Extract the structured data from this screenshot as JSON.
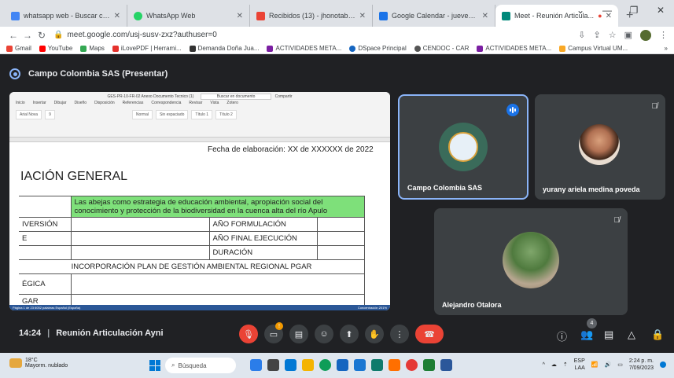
{
  "browser": {
    "tabs": [
      {
        "label": "whatsapp web - Buscar con ...",
        "color": "#4285f4"
      },
      {
        "label": "WhatsApp Web",
        "color": "#25d366"
      },
      {
        "label": "Recibidos (13) - jhonotabo...",
        "color": "#ea4335"
      },
      {
        "label": "Google Calendar - jueves, 7...",
        "color": "#1a73e8"
      },
      {
        "label": "Meet - Reunión Articula...",
        "color": "#00897b"
      }
    ],
    "new_tab": "+",
    "url": "meet.google.com/usj-susv-zxz?authuser=0",
    "bookmarks": [
      "Gmail",
      "YouTube",
      "Maps",
      "iLovePDF | Herrami...",
      "Demanda Doña Jua...",
      "ACTIVIDADES META...",
      "DSpace Principal",
      "CENDOC - CAR",
      "ACTIVIDADES META...",
      "Campus Virtual UM..."
    ],
    "bookmarks_more": "»"
  },
  "meet": {
    "presenting_label": "Campo Colombia SAS (Presentar)",
    "meeting_time": "14:24",
    "meeting_name": "Reunión Articulación Ayni",
    "participant_count": "4",
    "participants": [
      {
        "name": "Campo Colombia SAS"
      },
      {
        "name": "yurany ariela medina poveda"
      },
      {
        "name": "Alejandro Otalora"
      }
    ]
  },
  "document": {
    "app_title": "GES-PR-10-FR-02 Anexo Documento Tecnico (1)",
    "search_placeholder": "Buscar en documento",
    "share": "Compartir",
    "menu": [
      "Inicio",
      "Insertar",
      "Dibujar",
      "Diseño",
      "Disposición",
      "Referencias",
      "Correspondencia",
      "Revisar",
      "Vista",
      "Zotero"
    ],
    "font_name": "Arial Nova",
    "font_size": "9",
    "styles": [
      "Normal",
      "Sin espaciado",
      "Título 1",
      "Título 2"
    ],
    "date_line": "Fecha de elaboración: XX de XXXXXX de 2022",
    "heading": "IACIÓN GENERAL",
    "project_title": "Las abejas como estrategia de educación ambiental, apropiación social del conocimiento y protección de la biodiversidad en la cuenca alta del río Apulo",
    "rows": [
      {
        "left": "IVERSIÓN",
        "right": "AÑO FORMULACIÓN"
      },
      {
        "left": "E",
        "right": "AÑO FINAL EJECUCIÓN"
      },
      {
        "left": "",
        "right": "DURACIÓN"
      }
    ],
    "pgar": "INCORPORACIÓN PLAN DE GESTIÓN AMBIENTAL REGIONAL PGAR",
    "tail_rows": [
      "ÉGICA",
      "GAR"
    ],
    "status_left": "Página 1 de 23   6052 palabras   Español (España)",
    "status_right": "Concentración   201%"
  },
  "taskbar": {
    "temperature": "18°C",
    "weather": "Mayorm. nublado",
    "search": "Búsqueda",
    "lang": "ESP",
    "layout": "LAA",
    "time": "2:24 p. m.",
    "date": "7/09/2023"
  }
}
